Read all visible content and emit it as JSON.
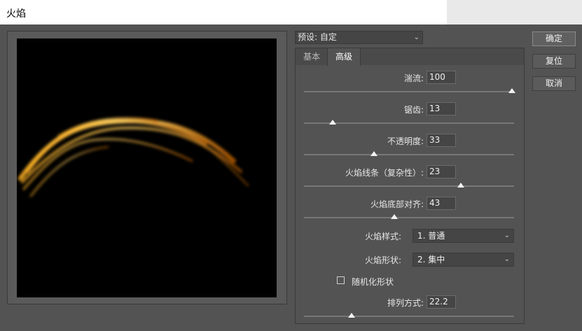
{
  "window": {
    "title": "火焰"
  },
  "preset": {
    "label": "预设: 自定"
  },
  "tabs": [
    {
      "label": "基本"
    },
    {
      "label": "高级"
    }
  ],
  "params": {
    "turbulence": {
      "label": "湍流:",
      "value": "100",
      "fraction": 1.0
    },
    "jag": {
      "label": "锯齿:",
      "value": "13",
      "fraction": 0.13
    },
    "opacity": {
      "label": "不透明度:",
      "value": "33",
      "fraction": 0.33
    },
    "complexity": {
      "label": "火焰线条（复杂性）:",
      "value": "23",
      "fraction": 0.75
    },
    "bottom_align": {
      "label": "火焰底部对齐:",
      "value": "43",
      "fraction": 0.43
    },
    "arrangement": {
      "label": "排列方式:",
      "value": "22.2",
      "fraction": 0.22
    }
  },
  "style": {
    "label": "火焰样式:",
    "value": "1. 普通"
  },
  "shape": {
    "label": "火焰形状:",
    "value": "2. 集中"
  },
  "random_shape": {
    "label": "随机化形状",
    "checked": false
  },
  "buttons": {
    "ok": "确定",
    "reset": "复位",
    "cancel": "取消"
  }
}
